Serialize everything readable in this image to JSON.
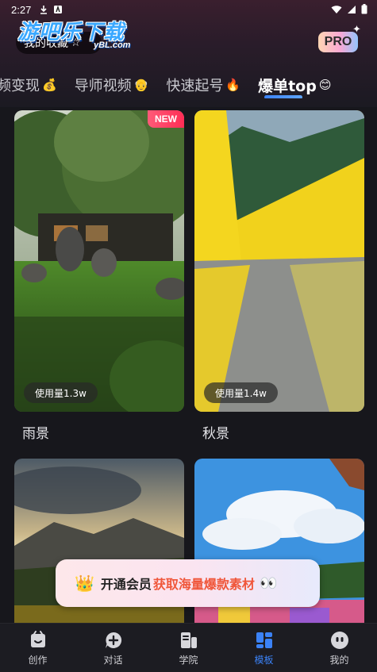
{
  "status_bar": {
    "time": "2:27"
  },
  "header": {
    "favorites_label": "我的收藏",
    "favorites_icon": "star-icon",
    "pro_label": "PRO",
    "watermark_main": "游吧乐下载",
    "watermark_sub": "yBL.com"
  },
  "tabs": [
    {
      "label": "频变现",
      "emoji": "💰",
      "active": false
    },
    {
      "label": "导师视频",
      "emoji": "👴",
      "active": false
    },
    {
      "label": "快速起号",
      "emoji": "🔥",
      "active": false
    },
    {
      "label": "爆单top",
      "emoji": "😊",
      "active": true
    }
  ],
  "cards": [
    {
      "title": "雨景",
      "usage": "使用量1.3w",
      "badge": "NEW"
    },
    {
      "title": "秋景",
      "usage": "使用量1.4w",
      "badge": ""
    },
    {
      "title": "",
      "usage": "",
      "badge": ""
    },
    {
      "title": "",
      "usage": "",
      "badge": ""
    }
  ],
  "promo": {
    "text_main": "开通会员",
    "text_highlight": "获取海量爆款素材",
    "crown_icon": "crown-icon",
    "eyes_icon": "eyes-icon"
  },
  "bottom_nav": [
    {
      "label": "创作",
      "icon": "create-icon",
      "active": false
    },
    {
      "label": "对话",
      "icon": "chat-icon",
      "active": false
    },
    {
      "label": "学院",
      "icon": "academy-icon",
      "active": false
    },
    {
      "label": "模板",
      "icon": "template-icon",
      "active": true
    },
    {
      "label": "我的",
      "icon": "profile-icon",
      "active": false
    }
  ],
  "colors": {
    "accent": "#3b82f6",
    "new_badge": "#ff2d55",
    "promo_highlight": "#f0573b",
    "background": "#17171c"
  }
}
